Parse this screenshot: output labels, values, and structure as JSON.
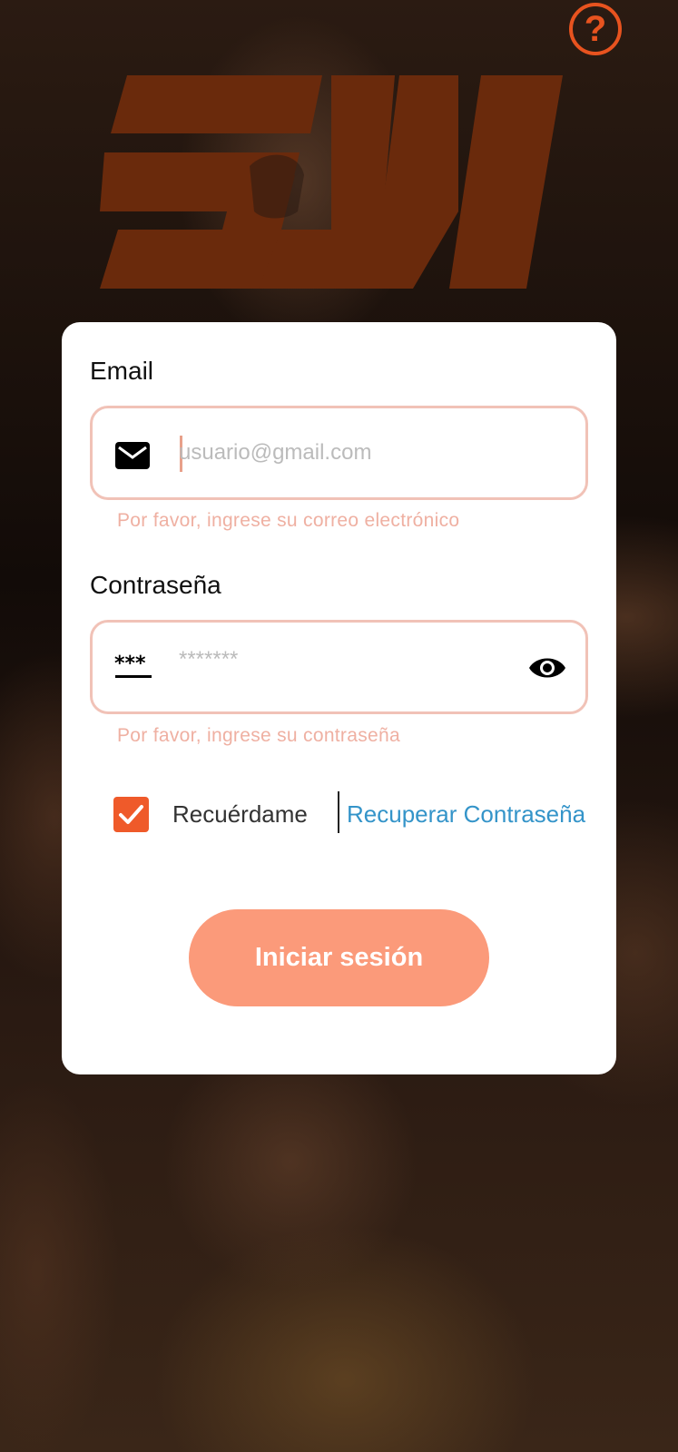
{
  "header": {
    "help_icon": "help-circle-icon",
    "help_symbol": "?",
    "logo_text": "SM"
  },
  "form": {
    "email": {
      "label": "Email",
      "placeholder": "usuario@gmail.com",
      "icon": "mail-icon",
      "helper": "Por favor, ingrese su correo electrónico"
    },
    "password": {
      "label": "Contraseña",
      "placeholder": "*******",
      "icon": "password-icon",
      "toggle_icon": "eye-icon",
      "helper": "Por favor, ingrese su contraseña"
    },
    "remember": {
      "label": "Recuérdame",
      "checked": true
    },
    "recover_link": "Recuperar Contraseña",
    "submit_label": "Iniciar sesión"
  },
  "colors": {
    "brand_orange": "#e8531f",
    "logo_brown": "#6a2a0c",
    "checkbox": "#ef5a2a",
    "button": "#fb9a7a",
    "link": "#3494c9",
    "error_text": "#efb0a2",
    "field_border": "#f1c2b7"
  }
}
